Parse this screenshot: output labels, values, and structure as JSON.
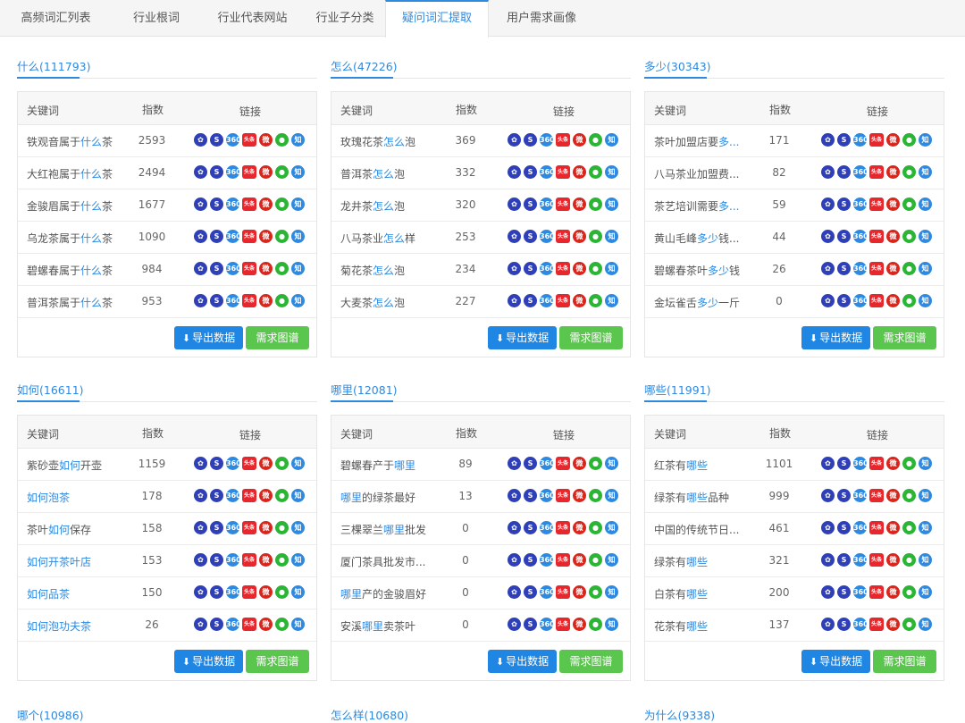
{
  "tabs": [
    {
      "label": "高频词汇列表",
      "active": false
    },
    {
      "label": "行业根词",
      "active": false
    },
    {
      "label": "行业代表网站",
      "active": false
    },
    {
      "label": "行业子分类",
      "active": false
    },
    {
      "label": "疑问词汇提取",
      "active": true
    },
    {
      "label": "用户需求画像",
      "active": false
    }
  ],
  "table_headers": {
    "keyword": "关键词",
    "index": "指数",
    "links": "链接"
  },
  "buttons": {
    "export": "导出数据",
    "graph": "需求图谱"
  },
  "icons": [
    {
      "name": "baidu-icon",
      "glyph": "✿"
    },
    {
      "name": "sogou-icon",
      "glyph": "S"
    },
    {
      "name": "so360-icon",
      "glyph": "360"
    },
    {
      "name": "toutiao-icon",
      "glyph": "头条"
    },
    {
      "name": "weibo-icon",
      "glyph": "微"
    },
    {
      "name": "wechat-icon",
      "glyph": "●"
    },
    {
      "name": "zhihu-icon",
      "glyph": "知"
    }
  ],
  "colors": {
    "accent": "#2d8ae0",
    "export_btn": "#1f86e3",
    "graph_btn": "#5bc64d"
  },
  "panels": [
    {
      "title": "什么(111793)",
      "rows": [
        {
          "pre": "铁观音属于",
          "hl": "什么",
          "post": "茶",
          "index": "2593"
        },
        {
          "pre": "大红袍属于",
          "hl": "什么",
          "post": "茶",
          "index": "2494"
        },
        {
          "pre": "金骏眉属于",
          "hl": "什么",
          "post": "茶",
          "index": "1677"
        },
        {
          "pre": "乌龙茶属于",
          "hl": "什么",
          "post": "茶",
          "index": "1090"
        },
        {
          "pre": "碧螺春属于",
          "hl": "什么",
          "post": "茶",
          "index": "984"
        },
        {
          "pre": "普洱茶属于",
          "hl": "什么",
          "post": "茶",
          "index": "953"
        }
      ]
    },
    {
      "title": "怎么(47226)",
      "rows": [
        {
          "pre": "玫瑰花茶",
          "hl": "怎么",
          "post": "泡",
          "index": "369"
        },
        {
          "pre": "普洱茶",
          "hl": "怎么",
          "post": "泡",
          "index": "332"
        },
        {
          "pre": "龙井茶",
          "hl": "怎么",
          "post": "泡",
          "index": "320"
        },
        {
          "pre": "八马茶业",
          "hl": "怎么",
          "post": "样",
          "index": "253"
        },
        {
          "pre": "菊花茶",
          "hl": "怎么",
          "post": "泡",
          "index": "234"
        },
        {
          "pre": "大麦茶",
          "hl": "怎么",
          "post": "泡",
          "index": "227"
        }
      ]
    },
    {
      "title": "多少(30343)",
      "rows": [
        {
          "pre": "茶叶加盟店要",
          "hl": "多...",
          "post": "",
          "index": "171"
        },
        {
          "pre": "八马茶业加盟费...",
          "hl": "",
          "post": "",
          "index": "82"
        },
        {
          "pre": "茶艺培训需要",
          "hl": "多...",
          "post": "",
          "index": "59"
        },
        {
          "pre": "黄山毛峰",
          "hl": "多少",
          "post": "钱...",
          "index": "44"
        },
        {
          "pre": "碧螺春茶叶",
          "hl": "多少",
          "post": "钱",
          "index": "26"
        },
        {
          "pre": "金坛雀舌",
          "hl": "多少",
          "post": "一斤",
          "index": "0"
        }
      ]
    },
    {
      "title": "如何(16611)",
      "rows": [
        {
          "pre": "紫砂壶",
          "hl": "如何",
          "post": "开壶",
          "index": "1159"
        },
        {
          "pre": "",
          "hl": "如何泡茶",
          "post": "",
          "index": "178"
        },
        {
          "pre": "茶叶",
          "hl": "如何",
          "post": "保存",
          "index": "158"
        },
        {
          "pre": "",
          "hl": "如何开茶叶店",
          "post": "",
          "index": "153"
        },
        {
          "pre": "",
          "hl": "如何品茶",
          "post": "",
          "index": "150"
        },
        {
          "pre": "",
          "hl": "如何泡功夫茶",
          "post": "",
          "index": "26"
        }
      ]
    },
    {
      "title": "哪里(12081)",
      "rows": [
        {
          "pre": "碧螺春产于",
          "hl": "哪里",
          "post": "",
          "index": "89"
        },
        {
          "pre": "",
          "hl": "哪里",
          "post": "的绿茶最好",
          "index": "13"
        },
        {
          "pre": "三棵翠兰",
          "hl": "哪里",
          "post": "批发",
          "index": "0"
        },
        {
          "pre": "厦门茶具批发市...",
          "hl": "",
          "post": "",
          "index": "0"
        },
        {
          "pre": "",
          "hl": "哪里",
          "post": "产的金骏眉好",
          "index": "0"
        },
        {
          "pre": "安溪",
          "hl": "哪里",
          "post": "卖茶叶",
          "index": "0"
        }
      ]
    },
    {
      "title": "哪些(11991)",
      "rows": [
        {
          "pre": "红茶有",
          "hl": "哪些",
          "post": "",
          "index": "1101"
        },
        {
          "pre": "绿茶有",
          "hl": "哪些",
          "post": "品种",
          "index": "999"
        },
        {
          "pre": "中国的传统节日...",
          "hl": "",
          "post": "",
          "index": "461"
        },
        {
          "pre": "绿茶有",
          "hl": "哪些",
          "post": "",
          "index": "321"
        },
        {
          "pre": "白茶有",
          "hl": "哪些",
          "post": "",
          "index": "200"
        },
        {
          "pre": "花茶有",
          "hl": "哪些",
          "post": "",
          "index": "137"
        }
      ]
    }
  ],
  "bottom_titles": [
    "哪个(10986)",
    "怎么样(10680)",
    "为什么(9338)"
  ]
}
